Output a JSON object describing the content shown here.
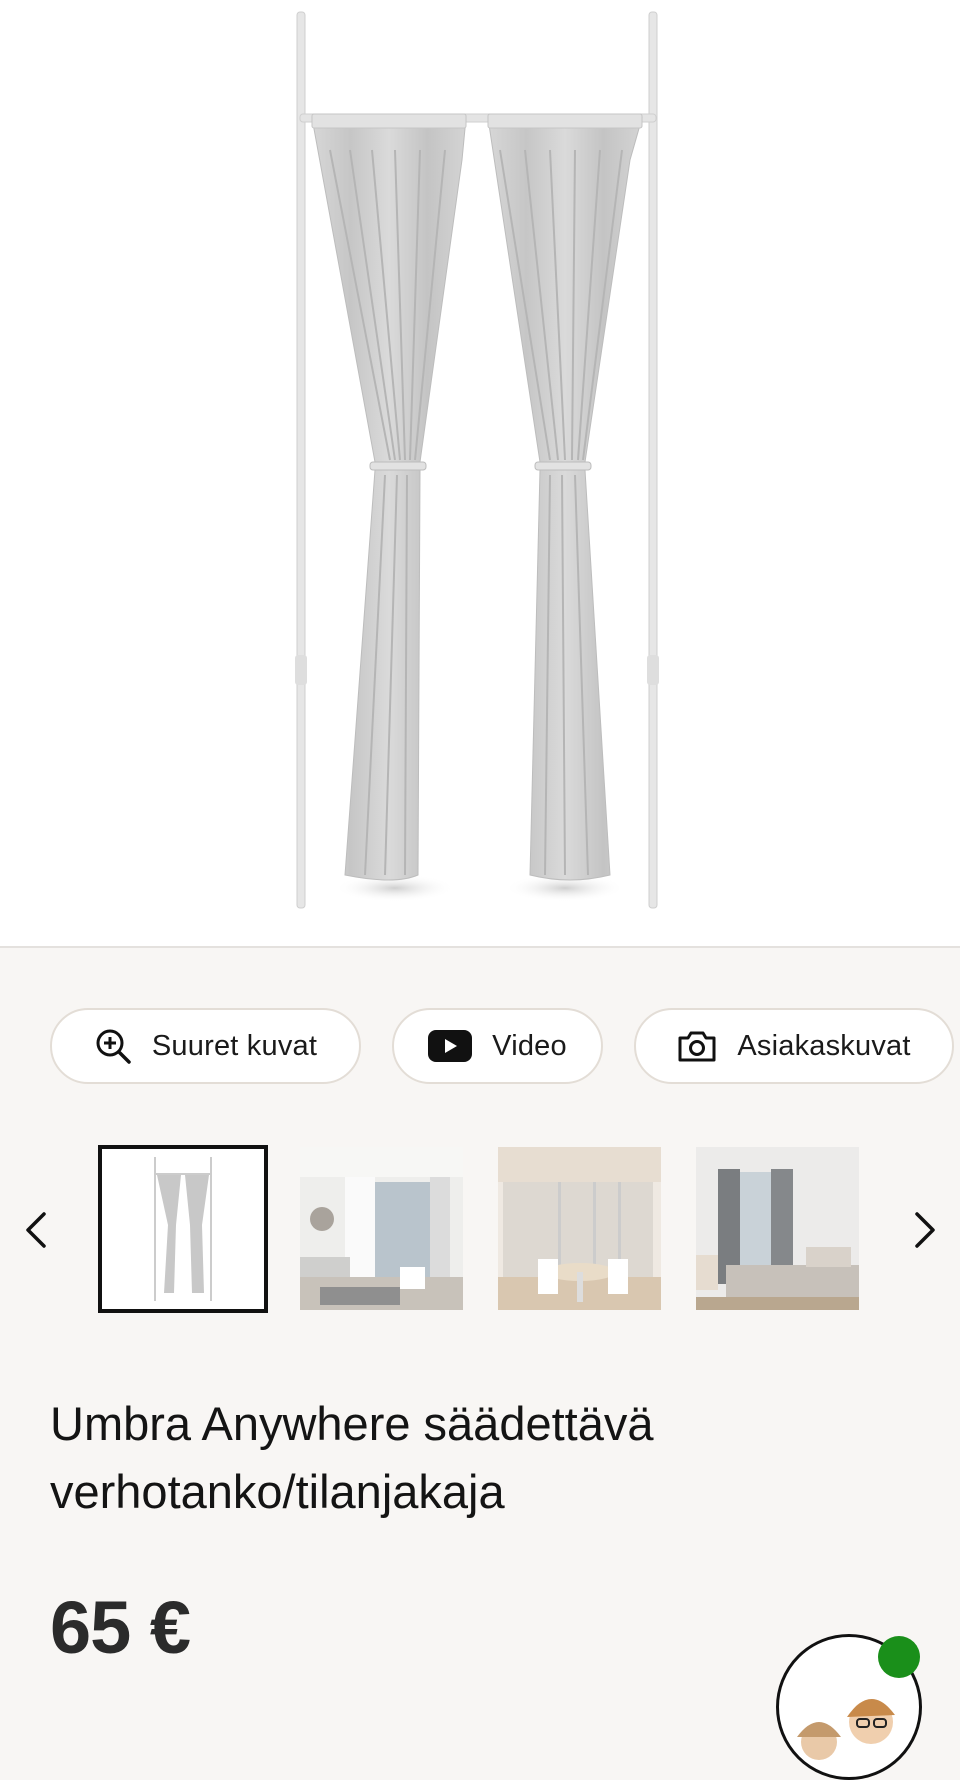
{
  "gallery": {
    "main_image_alt": "Umbra Anywhere curtain rod with two grey curtains",
    "actions": [
      {
        "label": "Suuret kuvat",
        "icon": "zoom-in-icon"
      },
      {
        "label": "Video",
        "icon": "play-icon"
      },
      {
        "label": "Asiakaskuvat",
        "icon": "camera-icon"
      }
    ],
    "prev_icon": "chevron-left-icon",
    "next_icon": "chevron-right-icon"
  },
  "product": {
    "title": "Umbra Anywhere säädettävä verhotanko/tilanjakaja",
    "price": "65 €"
  },
  "colors": {
    "background": "#f8f6f4",
    "pill_border": "#e3ddd6",
    "chat_status": "#1a8f1a"
  }
}
